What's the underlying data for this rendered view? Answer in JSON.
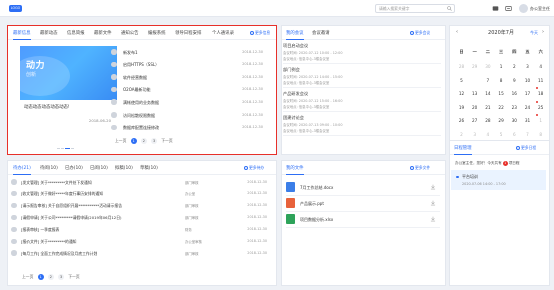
{
  "topbar": {
    "logo": "LOGO",
    "search_placeholder": "请输入搜索关键字",
    "user_name": "办公室主任"
  },
  "news": {
    "tabs": [
      "最新信息",
      "最新动态",
      "信息简报",
      "最新文件",
      "通知公告",
      "编报系统",
      "领导日程安排",
      "个人通讯录"
    ],
    "more_label": "更多信息",
    "banner": {
      "hero_title": "动力",
      "hero_subtitle": "创新",
      "caption": "动态动态动态动态动态!",
      "date": "2018-06-20"
    },
    "items": [
      {
        "title": "新发布1",
        "date": "2018-12-30"
      },
      {
        "title": "启用HTTPS（SSL）",
        "date": "2018-12-30"
      },
      {
        "title": "软件经营数据",
        "date": "2018-12-30"
      },
      {
        "title": "O2OA最新功能",
        "date": "2018-12-30"
      },
      {
        "title": "满帐使用的业务数据",
        "date": "2018-12-30"
      },
      {
        "title": "访问松散权限数据",
        "date": "2018-12-30"
      },
      {
        "title": "数据库配置连接修改",
        "date": "2018-12-30"
      }
    ],
    "pager": {
      "prev": "上一页",
      "pages": [
        "1",
        "2",
        "3"
      ],
      "next": "下一页"
    }
  },
  "meetings": {
    "tabs": [
      "我的会议",
      "会议邀请"
    ],
    "more_label": "更多会议",
    "items": [
      {
        "title": "项目启动会议",
        "time": "会议时间: 2020-07-12 10:00 - 12:00",
        "room": "会议地点: 信息中心-3楼会议室"
      },
      {
        "title": "部门例会",
        "time": "会议时间: 2020-07-12 14:00 - 15:00",
        "room": "会议地点: 信息中心-3楼会议室"
      },
      {
        "title": "产品研发会议",
        "time": "会议时间: 2020-07-12 15:00 - 16:00",
        "room": "会议地点: 信息中心-3楼会议室"
      },
      {
        "title": "团建讨论会",
        "time": "会议时间: 2020-07-13 09:00 - 10:00",
        "room": "会议地点: 信息中心-3楼会议室"
      }
    ]
  },
  "calendar": {
    "title": "2020年7月",
    "today_label": "今天",
    "weekdays": [
      "日",
      "一",
      "二",
      "三",
      "四",
      "五",
      "六"
    ],
    "weeks": [
      [
        "28",
        "29",
        "30",
        "1",
        "2",
        "3",
        "4"
      ],
      [
        "5",
        "6",
        "7",
        "8",
        "9",
        "10",
        "11"
      ],
      [
        "12",
        "13",
        "14",
        "15",
        "16",
        "17",
        "18"
      ],
      [
        "19",
        "20",
        "21",
        "22",
        "23",
        "24",
        "25"
      ],
      [
        "26",
        "27",
        "28",
        "29",
        "30",
        "31",
        "1"
      ],
      [
        "2",
        "3",
        "4",
        "5",
        "6",
        "7",
        "8"
      ]
    ],
    "today": "6"
  },
  "todo": {
    "tabs": [
      "待办(21)",
      "待阅(10)",
      "已办(10)",
      "已阅(10)",
      "拟稿(10)",
      "草稿(10)"
    ],
    "more_label": "更多待办",
    "items": [
      {
        "title": "[发文管理] 关于*********文件处下发通知",
        "dept": "部门审核",
        "date": "2018-12-30"
      },
      {
        "title": "[收文管理] 关于做好*****年度行事历安排的通知",
        "dept": "办公室",
        "date": "2018-12-30"
      },
      {
        "title": "[请示报告审核] 关于自愿组织开展***********活动请示报告",
        "dept": "部门审核",
        "date": "2018-12-30"
      },
      {
        "title": "[请假申请] 关于公司*********请假申请(2019年06月12日)",
        "dept": "部门审核",
        "date": "2018-12-30"
      },
      {
        "title": "[报表审核] 一季度报表",
        "dept": "财务",
        "date": "2018-12-30"
      },
      {
        "title": "[报价文件] 关于*********的通知",
        "dept": "办公室审核",
        "date": "2018-12-30"
      },
      {
        "title": "[每月工作] 全面工作完成情况及月底工作计划",
        "dept": "部门审核",
        "date": "2018-12-30"
      }
    ],
    "pager": {
      "prev": "上一页",
      "pages": [
        "1",
        "2",
        "3"
      ],
      "next": "下一页"
    }
  },
  "files": {
    "title": "我的文件",
    "more_label": "更多文件",
    "items": [
      {
        "name": "7月工作总结.docx",
        "kind": "doc",
        "color": "#3b7ee8"
      },
      {
        "name": "产品展示.ppt",
        "kind": "ppt",
        "color": "#e8623b"
      },
      {
        "name": "项目数据分析.xlsx",
        "kind": "xls",
        "color": "#2ea35a"
      }
    ]
  },
  "schedule": {
    "title": "日程管理",
    "more_label": "更多日程",
    "notice_prefix": "办公室主任，您好！今天共有",
    "notice_count": "1",
    "notice_suffix": "项日程",
    "item": {
      "title": "平台培训",
      "time": "2020-07-06 14:00 - 17:00"
    }
  },
  "colors": {
    "accent": "#2d6ef5",
    "highlight": "#e7302a"
  }
}
